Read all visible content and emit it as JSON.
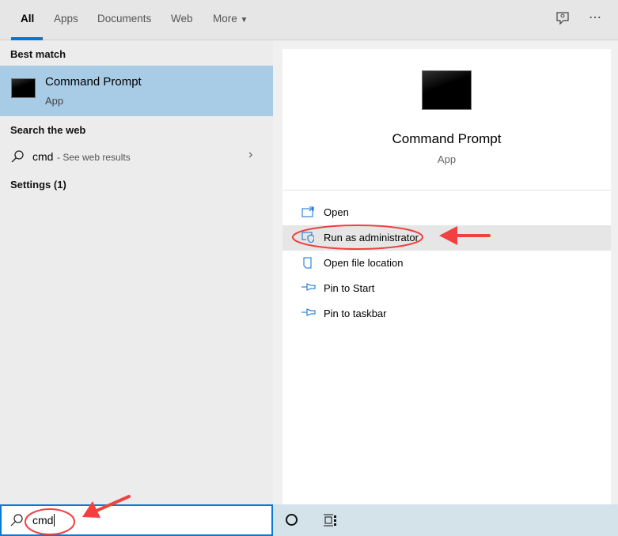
{
  "tabs": [
    {
      "label": "All"
    },
    {
      "label": "Apps"
    },
    {
      "label": "Documents"
    },
    {
      "label": "Web"
    },
    {
      "label": "More"
    }
  ],
  "toolbar": {
    "feedback_icon": "feedback-icon",
    "more_icon": "⋯"
  },
  "left": {
    "best_match_heading": "Best match",
    "best_match": {
      "title": "Command Prompt",
      "subtitle": "App"
    },
    "web_heading": "Search the web",
    "web_result": {
      "query": "cmd",
      "suffix": " - See web results"
    },
    "settings_heading": "Settings (1)"
  },
  "right": {
    "title": "Command Prompt",
    "subtitle": "App",
    "actions": [
      {
        "label": "Open",
        "icon": "open-icon"
      },
      {
        "label": "Run as administrator",
        "icon": "shield-icon"
      },
      {
        "label": "Open file location",
        "icon": "file-location-icon"
      },
      {
        "label": "Pin to Start",
        "icon": "pin-icon"
      },
      {
        "label": "Pin to taskbar",
        "icon": "pin-icon"
      }
    ]
  },
  "search": {
    "value": "cmd"
  },
  "colors": {
    "accent": "#0078d7",
    "highlight": "#a8cbe6",
    "annotation": "#f04040"
  }
}
